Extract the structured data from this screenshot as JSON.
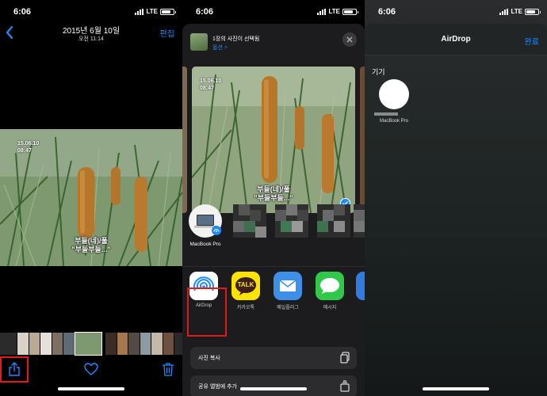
{
  "status": {
    "time": "6:06",
    "network": "LTE"
  },
  "panel1": {
    "date": "2015년 6월 10일",
    "time": "오전 11:14",
    "edit": "편집",
    "photo_stamp": "15.06.10\n08:47",
    "photo_caption": "부들(네)/풀\n\"부들부들...\"",
    "toolbar": {
      "share": "share-icon",
      "like": "heart-icon",
      "delete": "trash-icon"
    },
    "highlight_color": "#e21a1a",
    "accent": "#1a8cff"
  },
  "panel2": {
    "header": {
      "title": "1장의 사진이 선택됨",
      "options": "옵션 >"
    },
    "photo_caption": "부들(네)/풀\n\"부들부들...\"",
    "photo_stamp": "15.06.10\n08:47",
    "people": [
      {
        "label": "MacBook Pro"
      },
      {
        "label": ""
      },
      {
        "label": ""
      },
      {
        "label": ""
      }
    ],
    "apps": [
      {
        "label": "AirDrop",
        "icon": "airdrop-icon",
        "color": "#ffffff"
      },
      {
        "label": "카카오톡",
        "icon": "kakaotalk-icon",
        "color": "#fbe300",
        "text": "TALK"
      },
      {
        "label": "메일플러그",
        "icon": "mail-icon",
        "color": "#3f8ee8"
      },
      {
        "label": "메시지",
        "icon": "messages-icon",
        "color": "#2fc84a"
      },
      {
        "label": "",
        "icon": "app-icon-partial",
        "color": "#2f7de1"
      }
    ],
    "actions": [
      {
        "label": "사진 복사",
        "icon": "copy-icon"
      },
      {
        "label": "공유 앨범에 추가",
        "icon": "shared-album-icon"
      }
    ]
  },
  "panel3": {
    "title": "AirDrop",
    "done": "완료",
    "section": "기기",
    "device": "MacBook Pro"
  }
}
